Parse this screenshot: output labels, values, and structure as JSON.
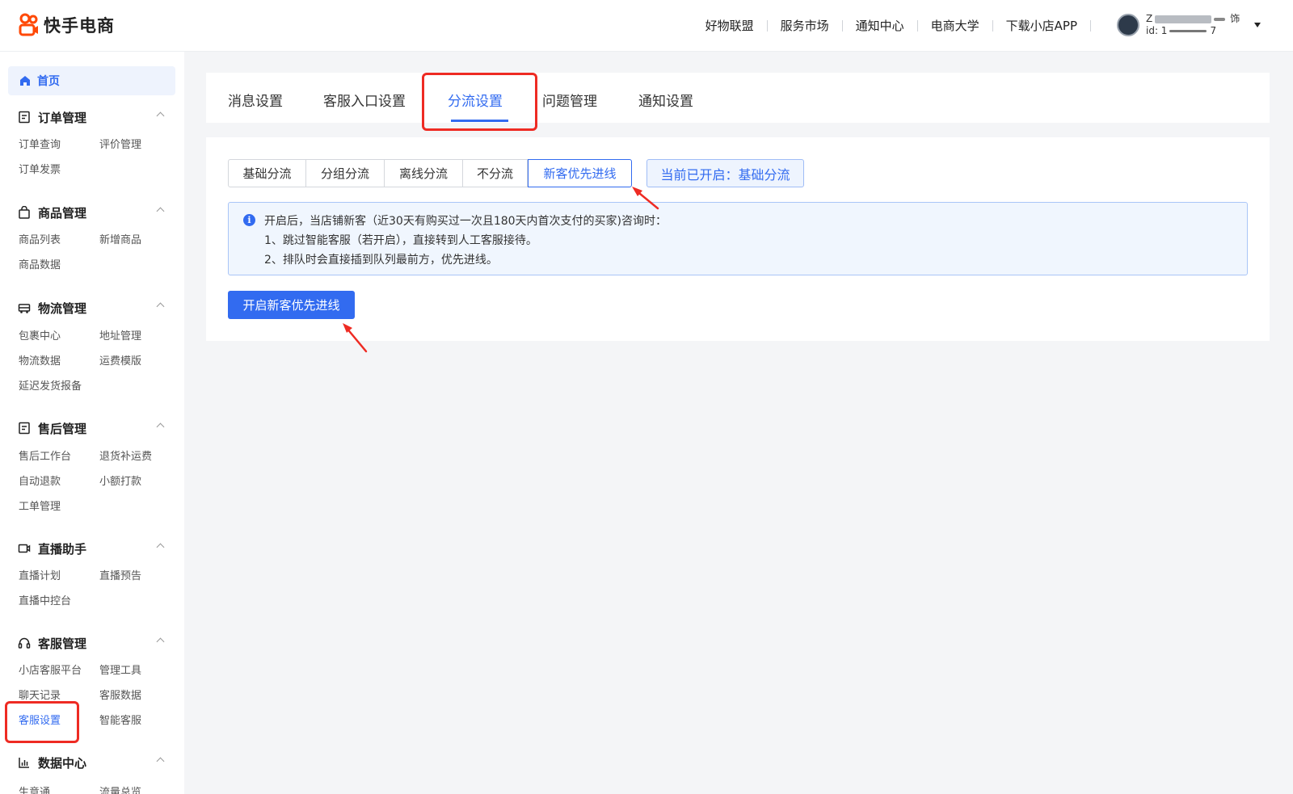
{
  "brand": {
    "name": "快手电商",
    "logo_icon": "kuaishou-logo-icon",
    "accent": "#326bf0"
  },
  "top_nav": [
    {
      "label": "好物联盟"
    },
    {
      "label": "服务市场"
    },
    {
      "label": "通知中心"
    },
    {
      "label": "电商大学"
    },
    {
      "label": "下载小店APP"
    }
  ],
  "user": {
    "name_prefix": "Z",
    "name_suffix": "饰",
    "id_prefix": "id: 1",
    "id_suffix": "7"
  },
  "sidebar": {
    "home": {
      "label": "首页",
      "icon": "home-icon"
    },
    "groups": [
      {
        "title": "订单管理",
        "icon": "order-icon",
        "items": [
          "订单查询",
          "评价管理",
          "订单发票"
        ]
      },
      {
        "title": "商品管理",
        "icon": "bag-icon",
        "items": [
          "商品列表",
          "新增商品",
          "商品数据"
        ]
      },
      {
        "title": "物流管理",
        "icon": "truck-icon",
        "items": [
          "包裹中心",
          "地址管理",
          "物流数据",
          "运费模版",
          "延迟发货报备"
        ]
      },
      {
        "title": "售后管理",
        "icon": "aftersale-icon",
        "items": [
          "售后工作台",
          "退货补运费",
          "自动退款",
          "小额打款",
          "工单管理"
        ]
      },
      {
        "title": "直播助手",
        "icon": "video-icon",
        "items": [
          "直播计划",
          "直播预告",
          "直播中控台"
        ]
      },
      {
        "title": "客服管理",
        "icon": "headset-icon",
        "items": [
          "小店客服平台",
          "管理工具",
          "聊天记录",
          "客服数据",
          "客服设置",
          "智能客服"
        ],
        "active_item": "客服设置"
      },
      {
        "title": "数据中心",
        "icon": "chart-icon",
        "items": [
          "生意通",
          "流量总览"
        ]
      }
    ]
  },
  "tabs": [
    {
      "label": "消息设置"
    },
    {
      "label": "客服入口设置"
    },
    {
      "label": "分流设置",
      "active": true
    },
    {
      "label": "问题管理"
    },
    {
      "label": "通知设置"
    }
  ],
  "routing_modes": [
    {
      "label": "基础分流"
    },
    {
      "label": "分组分流"
    },
    {
      "label": "离线分流"
    },
    {
      "label": "不分流"
    },
    {
      "label": "新客优先进线",
      "active": true
    }
  ],
  "current_status": "当前已开启：基础分流",
  "info": {
    "icon": "info-icon",
    "lines": [
      "开启后，当店铺新客（近30天有购买过一次且180天内首次支付的买家)咨询时：",
      "1、跳过智能客服（若开启），直接转到人工客服接待。",
      "2、排队时会直接插到队列最前方，优先进线。"
    ]
  },
  "enable_button": "开启新客优先进线",
  "annotation_color": "#ee2b23"
}
